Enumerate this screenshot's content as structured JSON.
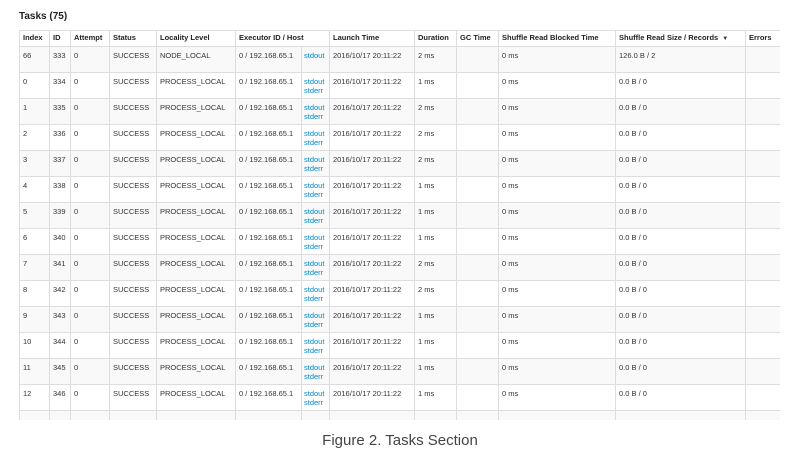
{
  "section": {
    "title": "Tasks (75)"
  },
  "columns": [
    "Index",
    "ID",
    "Attempt",
    "Status",
    "Locality Level",
    "Executor ID / Host",
    "",
    "Launch Time",
    "Duration",
    "GC Time",
    "Shuffle Read Blocked Time",
    "Shuffle Read Size / Records",
    "Errors"
  ],
  "sort_indicator": "▼",
  "rows": [
    {
      "index": "66",
      "id": "333",
      "attempt": "0",
      "status": "SUCCESS",
      "locality": "NODE_LOCAL",
      "executor": "0 / 192.168.65.1",
      "stdout": "stdout",
      "stderr": "",
      "launch": "2016/10/17 20:11:22",
      "duration": "2 ms",
      "gc": "",
      "blocked": "0 ms",
      "shuffle": "126.0 B / 2",
      "errors": ""
    },
    {
      "index": "0",
      "id": "334",
      "attempt": "0",
      "status": "SUCCESS",
      "locality": "PROCESS_LOCAL",
      "executor": "0 / 192.168.65.1",
      "stdout": "stdout",
      "stderr": "stderr",
      "launch": "2016/10/17 20:11:22",
      "duration": "1 ms",
      "gc": "",
      "blocked": "0 ms",
      "shuffle": "0.0 B / 0",
      "errors": ""
    },
    {
      "index": "1",
      "id": "335",
      "attempt": "0",
      "status": "SUCCESS",
      "locality": "PROCESS_LOCAL",
      "executor": "0 / 192.168.65.1",
      "stdout": "stdout",
      "stderr": "stderr",
      "launch": "2016/10/17 20:11:22",
      "duration": "2 ms",
      "gc": "",
      "blocked": "0 ms",
      "shuffle": "0.0 B / 0",
      "errors": ""
    },
    {
      "index": "2",
      "id": "336",
      "attempt": "0",
      "status": "SUCCESS",
      "locality": "PROCESS_LOCAL",
      "executor": "0 / 192.168.65.1",
      "stdout": "stdout",
      "stderr": "stderr",
      "launch": "2016/10/17 20:11:22",
      "duration": "2 ms",
      "gc": "",
      "blocked": "0 ms",
      "shuffle": "0.0 B / 0",
      "errors": ""
    },
    {
      "index": "3",
      "id": "337",
      "attempt": "0",
      "status": "SUCCESS",
      "locality": "PROCESS_LOCAL",
      "executor": "0 / 192.168.65.1",
      "stdout": "stdout",
      "stderr": "stderr",
      "launch": "2016/10/17 20:11:22",
      "duration": "2 ms",
      "gc": "",
      "blocked": "0 ms",
      "shuffle": "0.0 B / 0",
      "errors": ""
    },
    {
      "index": "4",
      "id": "338",
      "attempt": "0",
      "status": "SUCCESS",
      "locality": "PROCESS_LOCAL",
      "executor": "0 / 192.168.65.1",
      "stdout": "stdout",
      "stderr": "stderr",
      "launch": "2016/10/17 20:11:22",
      "duration": "1 ms",
      "gc": "",
      "blocked": "0 ms",
      "shuffle": "0.0 B / 0",
      "errors": ""
    },
    {
      "index": "5",
      "id": "339",
      "attempt": "0",
      "status": "SUCCESS",
      "locality": "PROCESS_LOCAL",
      "executor": "0 / 192.168.65.1",
      "stdout": "stdout",
      "stderr": "stderr",
      "launch": "2016/10/17 20:11:22",
      "duration": "1 ms",
      "gc": "",
      "blocked": "0 ms",
      "shuffle": "0.0 B / 0",
      "errors": ""
    },
    {
      "index": "6",
      "id": "340",
      "attempt": "0",
      "status": "SUCCESS",
      "locality": "PROCESS_LOCAL",
      "executor": "0 / 192.168.65.1",
      "stdout": "stdout",
      "stderr": "stderr",
      "launch": "2016/10/17 20:11:22",
      "duration": "1 ms",
      "gc": "",
      "blocked": "0 ms",
      "shuffle": "0.0 B / 0",
      "errors": ""
    },
    {
      "index": "7",
      "id": "341",
      "attempt": "0",
      "status": "SUCCESS",
      "locality": "PROCESS_LOCAL",
      "executor": "0 / 192.168.65.1",
      "stdout": "stdout",
      "stderr": "stderr",
      "launch": "2016/10/17 20:11:22",
      "duration": "2 ms",
      "gc": "",
      "blocked": "0 ms",
      "shuffle": "0.0 B / 0",
      "errors": ""
    },
    {
      "index": "8",
      "id": "342",
      "attempt": "0",
      "status": "SUCCESS",
      "locality": "PROCESS_LOCAL",
      "executor": "0 / 192.168.65.1",
      "stdout": "stdout",
      "stderr": "stderr",
      "launch": "2016/10/17 20:11:22",
      "duration": "2 ms",
      "gc": "",
      "blocked": "0 ms",
      "shuffle": "0.0 B / 0",
      "errors": ""
    },
    {
      "index": "9",
      "id": "343",
      "attempt": "0",
      "status": "SUCCESS",
      "locality": "PROCESS_LOCAL",
      "executor": "0 / 192.168.65.1",
      "stdout": "stdout",
      "stderr": "stderr",
      "launch": "2016/10/17 20:11:22",
      "duration": "1 ms",
      "gc": "",
      "blocked": "0 ms",
      "shuffle": "0.0 B / 0",
      "errors": ""
    },
    {
      "index": "10",
      "id": "344",
      "attempt": "0",
      "status": "SUCCESS",
      "locality": "PROCESS_LOCAL",
      "executor": "0 / 192.168.65.1",
      "stdout": "stdout",
      "stderr": "stderr",
      "launch": "2016/10/17 20:11:22",
      "duration": "1 ms",
      "gc": "",
      "blocked": "0 ms",
      "shuffle": "0.0 B / 0",
      "errors": ""
    },
    {
      "index": "11",
      "id": "345",
      "attempt": "0",
      "status": "SUCCESS",
      "locality": "PROCESS_LOCAL",
      "executor": "0 / 192.168.65.1",
      "stdout": "stdout",
      "stderr": "stderr",
      "launch": "2016/10/17 20:11:22",
      "duration": "1 ms",
      "gc": "",
      "blocked": "0 ms",
      "shuffle": "0.0 B / 0",
      "errors": ""
    },
    {
      "index": "12",
      "id": "346",
      "attempt": "0",
      "status": "SUCCESS",
      "locality": "PROCESS_LOCAL",
      "executor": "0 / 192.168.65.1",
      "stdout": "stdout",
      "stderr": "stderr",
      "launch": "2016/10/17 20:11:22",
      "duration": "1 ms",
      "gc": "",
      "blocked": "0 ms",
      "shuffle": "0.0 B / 0",
      "errors": ""
    },
    {
      "index": "",
      "id": "",
      "attempt": "",
      "status": "",
      "locality": "",
      "executor": "",
      "stdout": "",
      "stderr": "",
      "launch": "",
      "duration": "",
      "gc": "",
      "blocked": "",
      "shuffle": "",
      "errors": ""
    }
  ],
  "caption": "Figure 2. Tasks Section"
}
